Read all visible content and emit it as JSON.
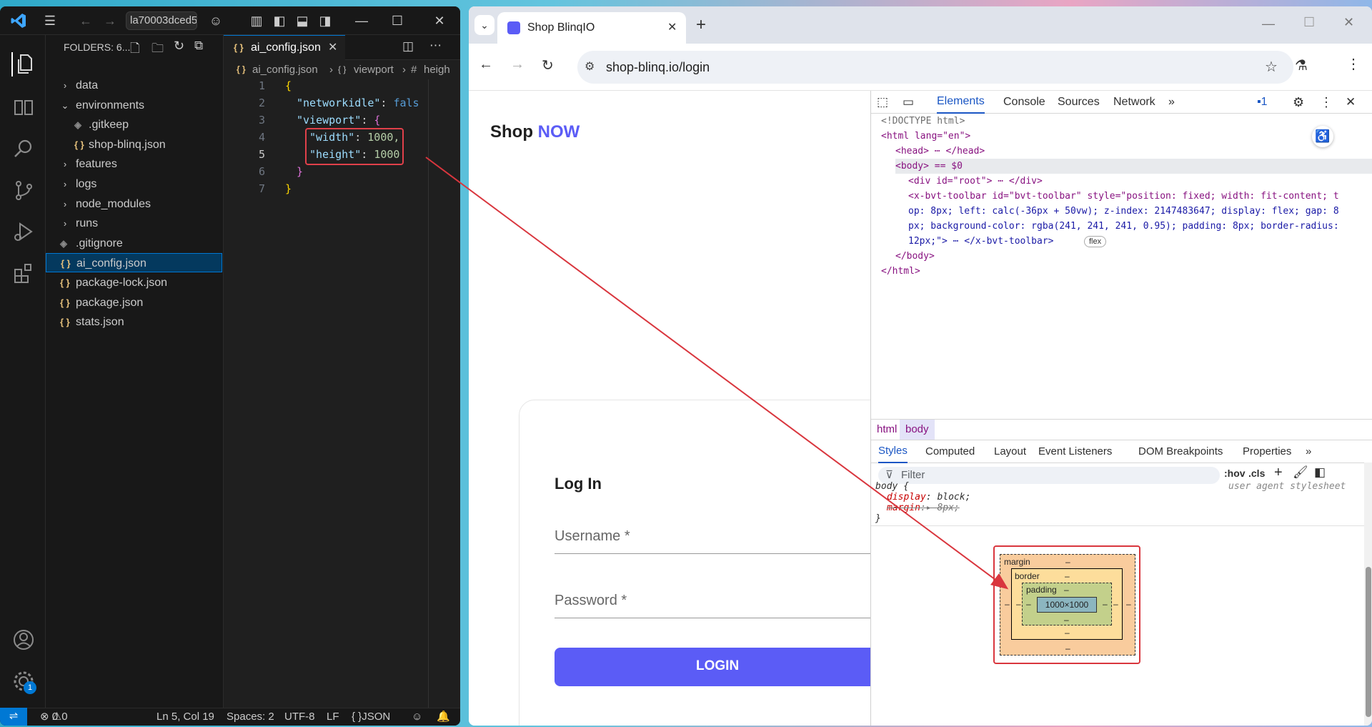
{
  "vscode": {
    "search_text": "la70003dced5",
    "explorer_title": "FOLDERS: 6...",
    "tree": [
      {
        "label": "data",
        "kind": "folder",
        "indent": 0
      },
      {
        "label": "environments",
        "kind": "folder-open",
        "indent": 0
      },
      {
        "label": ".gitkeep",
        "kind": "git",
        "indent": 1
      },
      {
        "label": "shop-blinq.json",
        "kind": "json",
        "indent": 1
      },
      {
        "label": "features",
        "kind": "folder",
        "indent": 0
      },
      {
        "label": "logs",
        "kind": "folder",
        "indent": 0
      },
      {
        "label": "node_modules",
        "kind": "folder",
        "indent": 0
      },
      {
        "label": "runs",
        "kind": "folder",
        "indent": 0
      },
      {
        "label": ".gitignore",
        "kind": "git",
        "indent": 0
      },
      {
        "label": "ai_config.json",
        "kind": "json",
        "indent": 0,
        "selected": true
      },
      {
        "label": "package-lock.json",
        "kind": "json",
        "indent": 0
      },
      {
        "label": "package.json",
        "kind": "json",
        "indent": 0
      },
      {
        "label": "stats.json",
        "kind": "json",
        "indent": 0
      }
    ],
    "tab_label": "ai_config.json",
    "breadcrumb": [
      "ai_config.json",
      "viewport",
      "heigh"
    ],
    "code_lines": [
      {
        "n": "1",
        "text": "{"
      },
      {
        "n": "2",
        "key": "\"networkidle\"",
        "val": "fals"
      },
      {
        "n": "3",
        "key": "\"viewport\"",
        "val": "{"
      },
      {
        "n": "4",
        "key": "\"width\"",
        "val": "1000,"
      },
      {
        "n": "5",
        "key": "\"height\"",
        "val": "1000"
      },
      {
        "n": "6",
        "text": "}"
      },
      {
        "n": "7",
        "text": "}"
      }
    ],
    "status": {
      "errors": "0",
      "warnings": "0",
      "position": "Ln 5, Col 19",
      "spaces": "Spaces: 2",
      "encoding": "UTF-8",
      "eol": "LF",
      "language": "JSON",
      "settings_badge": "1"
    }
  },
  "browser": {
    "tab_title": "Shop BlinqIO",
    "url": "shop-blinq.io/login",
    "page": {
      "brand_prefix": "Shop",
      "brand_suffix": "NOW",
      "login_title": "Log In",
      "username_label": "Username *",
      "password_label": "Password *",
      "login_button": "LOGIN"
    },
    "devtools": {
      "tabs": [
        "Elements",
        "Console",
        "Sources",
        "Network"
      ],
      "issues_count": "1",
      "dom_lines": [
        "<!DOCTYPE html>",
        "<html lang=\"en\">",
        "<head> ⋯ </head>",
        "<body> == $0",
        "<div id=\"root\"> ⋯ </div>",
        "<x-bvt-toolbar id=\"bvt-toolbar\" style=\"position: fixed; width: fit-content; t",
        "op: 8px; left: calc(-36px + 50vw); z-index: 2147483647; display: flex; gap: 8",
        "px; background-color: rgba(241, 241, 241, 0.95); padding: 8px; border-radius:",
        "12px;\"> ⋯ </x-bvt-toolbar>",
        "</body>",
        "</html>"
      ],
      "flex_badge": "flex",
      "crumbs": [
        "html",
        "body"
      ],
      "style_tabs": [
        "Styles",
        "Computed",
        "Layout",
        "Event Listeners",
        "DOM Breakpoints",
        "Properties"
      ],
      "filter_placeholder": "Filter",
      "hov": ":hov",
      "cls": ".cls",
      "css_selector": "body {",
      "css_source": "user agent stylesheet",
      "css_rules": [
        {
          "prop": "display",
          "value": "block;",
          "struck": false
        },
        {
          "prop": "margin",
          "value": "8px;",
          "struck": true
        }
      ],
      "box_model": {
        "margin_label": "margin",
        "border_label": "border",
        "padding_label": "padding",
        "content": "1000×1000",
        "dash": "–"
      }
    }
  },
  "colors": {
    "accent": "#5b5cf6",
    "annotation": "#d9363e",
    "vscode_bg": "#1f1f1f"
  }
}
